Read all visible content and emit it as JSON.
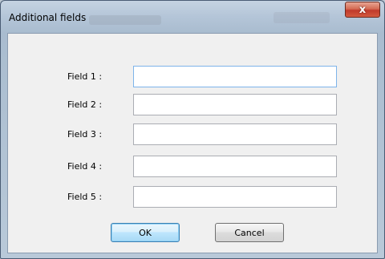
{
  "window": {
    "title": "Additional fields",
    "close_symbol": "x"
  },
  "fields": [
    {
      "label": "Field 1 :",
      "value": "",
      "focused": true
    },
    {
      "label": "Field 2 :",
      "value": ""
    },
    {
      "label": "Field 3 :",
      "value": ""
    },
    {
      "label": "Field 4 :",
      "value": ""
    },
    {
      "label": "Field 5 :",
      "value": ""
    }
  ],
  "buttons": {
    "ok_label": "OK",
    "cancel_label": "Cancel"
  },
  "icons": {
    "close": "close-icon"
  },
  "colors": {
    "focus_border": "#7eb4ea",
    "default_button": "#bee6fd",
    "close_button": "#c0392b"
  }
}
